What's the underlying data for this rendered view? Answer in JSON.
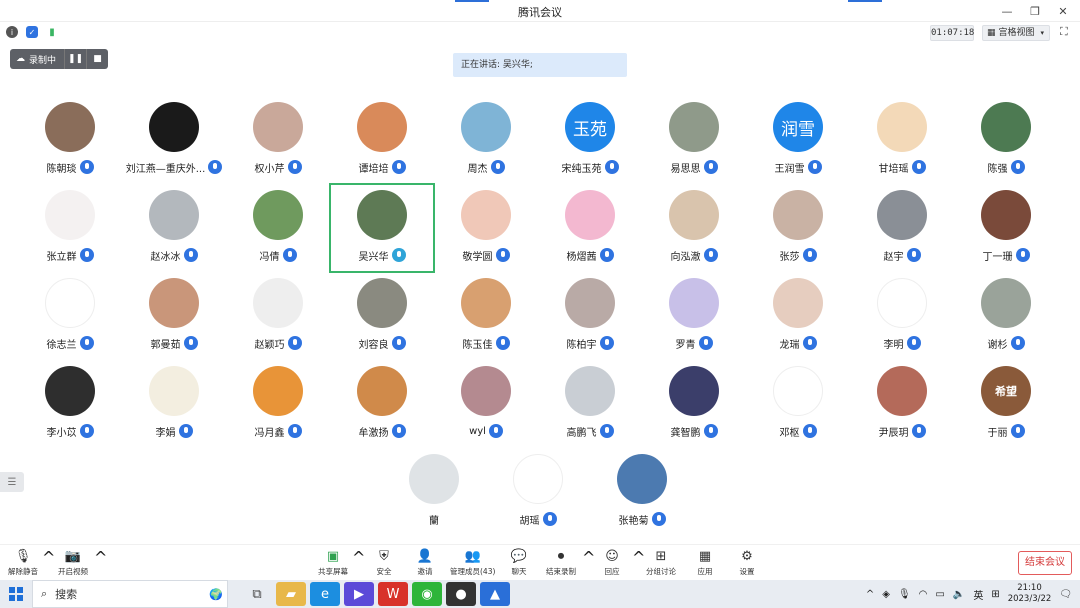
{
  "window": {
    "title": "腾讯会议"
  },
  "status": {
    "timer": "01:07:18",
    "view_label": "宫格视图"
  },
  "recording": {
    "label": "录制中"
  },
  "speaking": {
    "text": "正在讲话: 吴兴华;"
  },
  "participants": [
    [
      {
        "name": "陈朝琰",
        "avatar_text": "",
        "avatar_color": "#8a6d5a"
      },
      {
        "name": "刘江燕—重庆外...",
        "avatar_text": "",
        "avatar_color": "#1a1a1a"
      },
      {
        "name": "权小芹",
        "avatar_text": "",
        "avatar_color": "#c9a89a"
      },
      {
        "name": "谭培培",
        "avatar_text": "",
        "avatar_color": "#d98a5a"
      },
      {
        "name": "周杰",
        "avatar_text": "",
        "avatar_color": "#7fb4d6"
      },
      {
        "name": "宋纯玉苑",
        "avatar_text": "玉苑",
        "avatar_color": "#1f86e8"
      },
      {
        "name": "易思思",
        "avatar_text": "",
        "avatar_color": "#8f9a8a"
      },
      {
        "name": "王润雪",
        "avatar_text": "润雪",
        "avatar_color": "#1f86e8"
      },
      {
        "name": "甘培瑶",
        "avatar_text": "",
        "avatar_color": "#f3d9b8"
      },
      {
        "name": "陈强",
        "avatar_text": "",
        "avatar_color": "#4d7a52"
      }
    ],
    [
      {
        "name": "张立群",
        "avatar_text": "",
        "avatar_color": "#f4f1f1"
      },
      {
        "name": "赵冰冰",
        "avatar_text": "",
        "avatar_color": "#b3b8bd"
      },
      {
        "name": "冯倩",
        "avatar_text": "",
        "avatar_color": "#6f9a5e"
      },
      {
        "name": "吴兴华",
        "avatar_text": "",
        "avatar_color": "#5e7a55"
      },
      {
        "name": "敬学圆",
        "avatar_text": "",
        "avatar_color": "#f0c8b8"
      },
      {
        "name": "杨熠茜",
        "avatar_text": "",
        "avatar_color": "#f3b8d0"
      },
      {
        "name": "向泓澈",
        "avatar_text": "",
        "avatar_color": "#d9c4ad"
      },
      {
        "name": "张莎",
        "avatar_text": "",
        "avatar_color": "#c9b2a4"
      },
      {
        "name": "赵宇",
        "avatar_text": "",
        "avatar_color": "#8a8f96"
      },
      {
        "name": "丁一珊",
        "avatar_text": "",
        "avatar_color": "#7a4a3a"
      }
    ],
    [
      {
        "name": "徐志兰",
        "avatar_text": "",
        "avatar_color": "#ffffff"
      },
      {
        "name": "郭曼茹",
        "avatar_text": "",
        "avatar_color": "#c9967a"
      },
      {
        "name": "赵颖巧",
        "avatar_text": "",
        "avatar_color": "#eeeeee"
      },
      {
        "name": "刘容良",
        "avatar_text": "",
        "avatar_color": "#8a8a80"
      },
      {
        "name": "陈玉佳",
        "avatar_text": "",
        "avatar_color": "#d8a070"
      },
      {
        "name": "陈柏宇",
        "avatar_text": "",
        "avatar_color": "#b9aaa6"
      },
      {
        "name": "罗青",
        "avatar_text": "",
        "avatar_color": "#c8c0e8"
      },
      {
        "name": "龙瑞",
        "avatar_text": "",
        "avatar_color": "#e6cdbf"
      },
      {
        "name": "李明",
        "avatar_text": "",
        "avatar_color": "#ffffff"
      },
      {
        "name": "谢杉",
        "avatar_text": "",
        "avatar_color": "#9aa39a"
      }
    ],
    [
      {
        "name": "李小苡",
        "avatar_text": "",
        "avatar_color": "#2e2e2e"
      },
      {
        "name": "李娟",
        "avatar_text": "",
        "avatar_color": "#f3eee0"
      },
      {
        "name": "冯月鑫",
        "avatar_text": "",
        "avatar_color": "#e89438"
      },
      {
        "name": "牟激扬",
        "avatar_text": "",
        "avatar_color": "#d08a4a"
      },
      {
        "name": "wyl",
        "avatar_text": "",
        "avatar_color": "#b48a90"
      },
      {
        "name": "高鹏飞",
        "avatar_text": "",
        "avatar_color": "#c9ced4"
      },
      {
        "name": "龚智鹏",
        "avatar_text": "",
        "avatar_color": "#3b3e6a"
      },
      {
        "name": "邓枢",
        "avatar_text": "",
        "avatar_color": "#ffffff"
      },
      {
        "name": "尹辰玥",
        "avatar_text": "",
        "avatar_color": "#b46a5a"
      },
      {
        "name": "于丽",
        "avatar_text": "希望",
        "avatar_color": "#8a5a3a"
      }
    ],
    [
      {
        "name": "蘭",
        "avatar_text": "",
        "avatar_color": "#dfe3e6",
        "muted_icon": false
      },
      {
        "name": "胡瑶",
        "avatar_text": "",
        "avatar_color": "#ffffff"
      },
      {
        "name": "张艳菊",
        "avatar_text": "",
        "avatar_color": "#4c7ab0"
      }
    ]
  ],
  "toolbar": {
    "unmute": "解除静音",
    "start_video": "开启视频",
    "share_screen": "共享屏幕",
    "security": "安全",
    "invite": "邀请",
    "manage_members": "管理成员(43)",
    "chat": "聊天",
    "end_recording": "结束录制",
    "replay": "回应",
    "breakout": "分组讨论",
    "apps": "应用",
    "settings": "设置",
    "end_meeting": "结束会议"
  },
  "taskbar": {
    "search_placeholder": "搜索",
    "ime": "英",
    "time": "21:10",
    "date": "2023/3/22"
  },
  "colors": {
    "accent": "#2f73e0",
    "active_border": "#39b56a",
    "end": "#d43b3b"
  }
}
